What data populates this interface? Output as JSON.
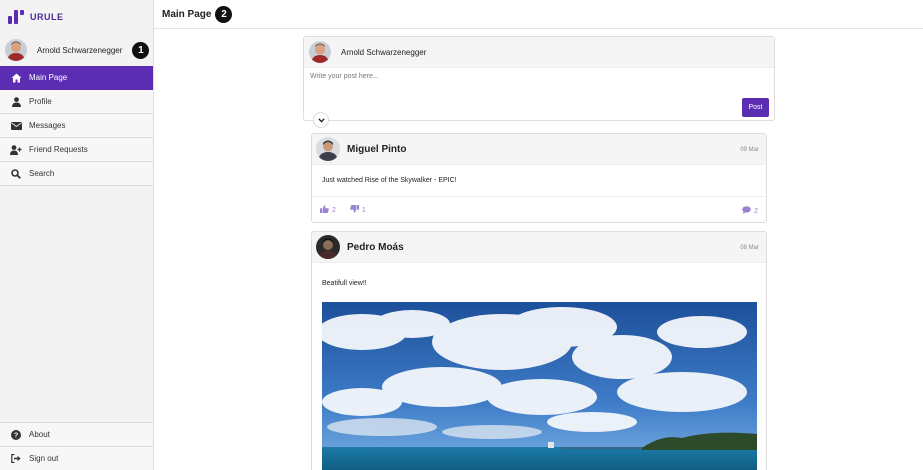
{
  "app": {
    "brand": "URULE"
  },
  "sidebar": {
    "user_name": "Arnold Schwarzenegger",
    "user_badge": "1",
    "items": [
      {
        "label": "Main Page",
        "icon": "home-icon"
      },
      {
        "label": "Profile",
        "icon": "user-icon"
      },
      {
        "label": "Messages",
        "icon": "envelope-icon"
      },
      {
        "label": "Friend Requests",
        "icon": "user-plus-icon"
      },
      {
        "label": "Search",
        "icon": "search-icon"
      }
    ],
    "bottom_items": [
      {
        "label": "About",
        "icon": "question-circle-icon"
      },
      {
        "label": "Sign out",
        "icon": "sign-out-icon"
      }
    ]
  },
  "header": {
    "title": "Main Page",
    "badge": "2"
  },
  "composer": {
    "user_name": "Arnold Schwarzenegger",
    "placeholder": "Write your post here...",
    "post_label": "Post"
  },
  "posts": [
    {
      "author": "Miguel Pinto",
      "date": "09 Mar",
      "text": "Just watched Rise of the Skywalker - EPIC!",
      "likes": "2",
      "dislikes": "1",
      "comments": "2"
    },
    {
      "author": "Pedro Moás",
      "date": "08 Mar",
      "text": "Beatifull view!!"
    }
  ],
  "colors": {
    "accent": "#5b2db3",
    "reaction": "#9a83cf"
  }
}
